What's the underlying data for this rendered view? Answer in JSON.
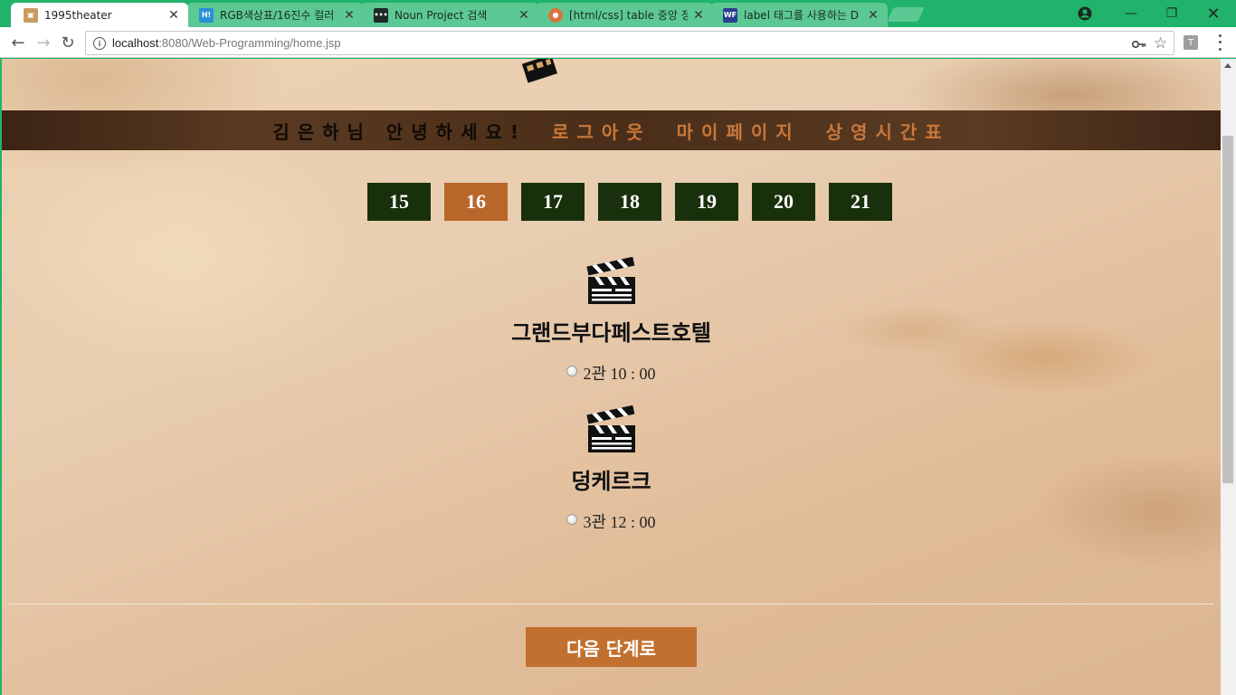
{
  "browser": {
    "tabs": [
      {
        "title": "1995theater",
        "favicon": "theater-favicon"
      },
      {
        "title": "RGB색상표/16진수 컬러",
        "favicon": "H-favicon"
      },
      {
        "title": "Noun Project 검색",
        "favicon": "noun-project-favicon"
      },
      {
        "title": "[html/css] table 중앙 정",
        "favicon": "blog-favicon"
      },
      {
        "title": "label 태그를 사용하는 D",
        "favicon": "WF-favicon"
      }
    ],
    "url": {
      "host": "localhost",
      "path": ":8080/Web-Programming/home.jsp"
    },
    "extension_label": "T"
  },
  "header": {
    "greeting": "김은하님 안녕하세요!",
    "nav": [
      "로그아웃",
      "마이페이지",
      "상영시간표"
    ]
  },
  "dates": {
    "items": [
      "15",
      "16",
      "17",
      "18",
      "19",
      "20",
      "21"
    ],
    "selected": "16"
  },
  "movies": [
    {
      "title": "그랜드부다페스트호텔",
      "slot": "2관 10 : 00"
    },
    {
      "title": "덩케르크",
      "slot": "3관 12 : 00"
    }
  ],
  "next_button": "다음 단계로",
  "colors": {
    "date_bg": "#19300c",
    "date_selected": "#b9662a",
    "nav_link": "#c9783a",
    "button": "#c2702f",
    "browser_frame": "#21b36b"
  }
}
